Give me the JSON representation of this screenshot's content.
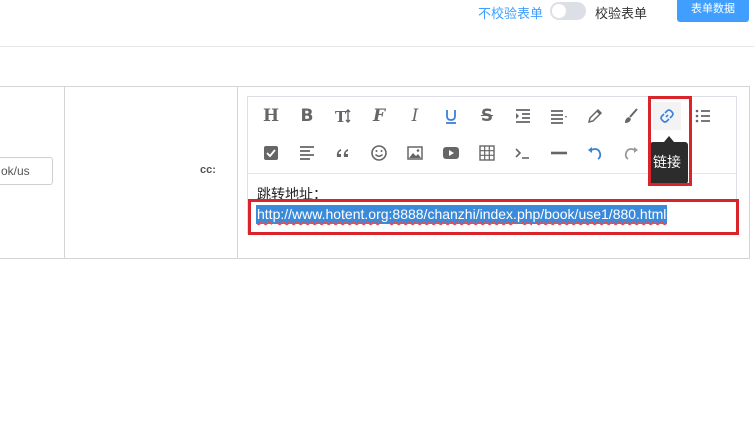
{
  "header": {
    "no_validate_label": "不校验表单",
    "validate_label": "校验表单",
    "form_data_button": "表单数据",
    "validate_toggle_on": false
  },
  "form": {
    "left_input_value": "ok/us",
    "cc_label": "cc:"
  },
  "editor": {
    "toolbar_row1": [
      "heading",
      "bold",
      "font-size",
      "font-family",
      "italic",
      "underline",
      "strikethrough",
      "indent",
      "align",
      "pen",
      "brush",
      "link",
      "list"
    ],
    "toolbar_row2": [
      "todo",
      "justify",
      "quote",
      "emoticon",
      "image",
      "video",
      "table",
      "code",
      "divider",
      "undo",
      "redo"
    ],
    "tooltip": "链接",
    "content_label": "跳转地址：",
    "selected_url": "http://www.hotent.org:8888/chanzhi/index.php/book/use1/880.html"
  },
  "colors": {
    "accent": "#409eff",
    "selection": "#3b8ad9",
    "highlight_box": "#d9242c",
    "tooltip_bg": "#2c2c2c"
  }
}
